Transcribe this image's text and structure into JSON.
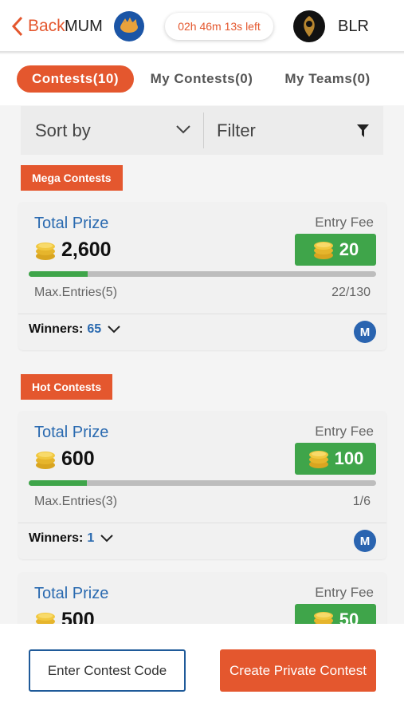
{
  "header": {
    "back_label": "Back",
    "team1": "MUM",
    "timer": "02h 46m 13s left",
    "team2": "BLR"
  },
  "tabs": [
    {
      "label": "Contests(10)",
      "active": true
    },
    {
      "label": "My Contests(0)",
      "active": false
    },
    {
      "label": "My Teams(0)",
      "active": false
    }
  ],
  "sortbar": {
    "sort_label": "Sort by",
    "filter_label": "Filter"
  },
  "sections": [
    {
      "title": "Mega Contests",
      "contests": [
        {
          "prize_label": "Total Prize",
          "prize": "2,600",
          "fee_label": "Entry Fee",
          "fee": "20",
          "max_entries": "Max.Entries(5)",
          "count": "22/130",
          "fill_fraction": 0.17,
          "winners_label": "Winners:",
          "winners": "65",
          "badge": "M"
        }
      ]
    },
    {
      "title": "Hot Contests",
      "contests": [
        {
          "prize_label": "Total Prize",
          "prize": "600",
          "fee_label": "Entry Fee",
          "fee": "100",
          "max_entries": "Max.Entries(3)",
          "count": "1/6",
          "fill_fraction": 0.167,
          "winners_label": "Winners:",
          "winners": "1",
          "badge": "M"
        },
        {
          "prize_label": "Total Prize",
          "prize": "500",
          "fee_label": "Entry Fee",
          "fee": "50"
        }
      ]
    }
  ],
  "footer": {
    "code_label": "Enter Contest Code",
    "private_label": "Create Private Contest"
  },
  "colors": {
    "accent": "#e4572e",
    "green": "#3fa54a",
    "blue": "#2a6ab0"
  }
}
